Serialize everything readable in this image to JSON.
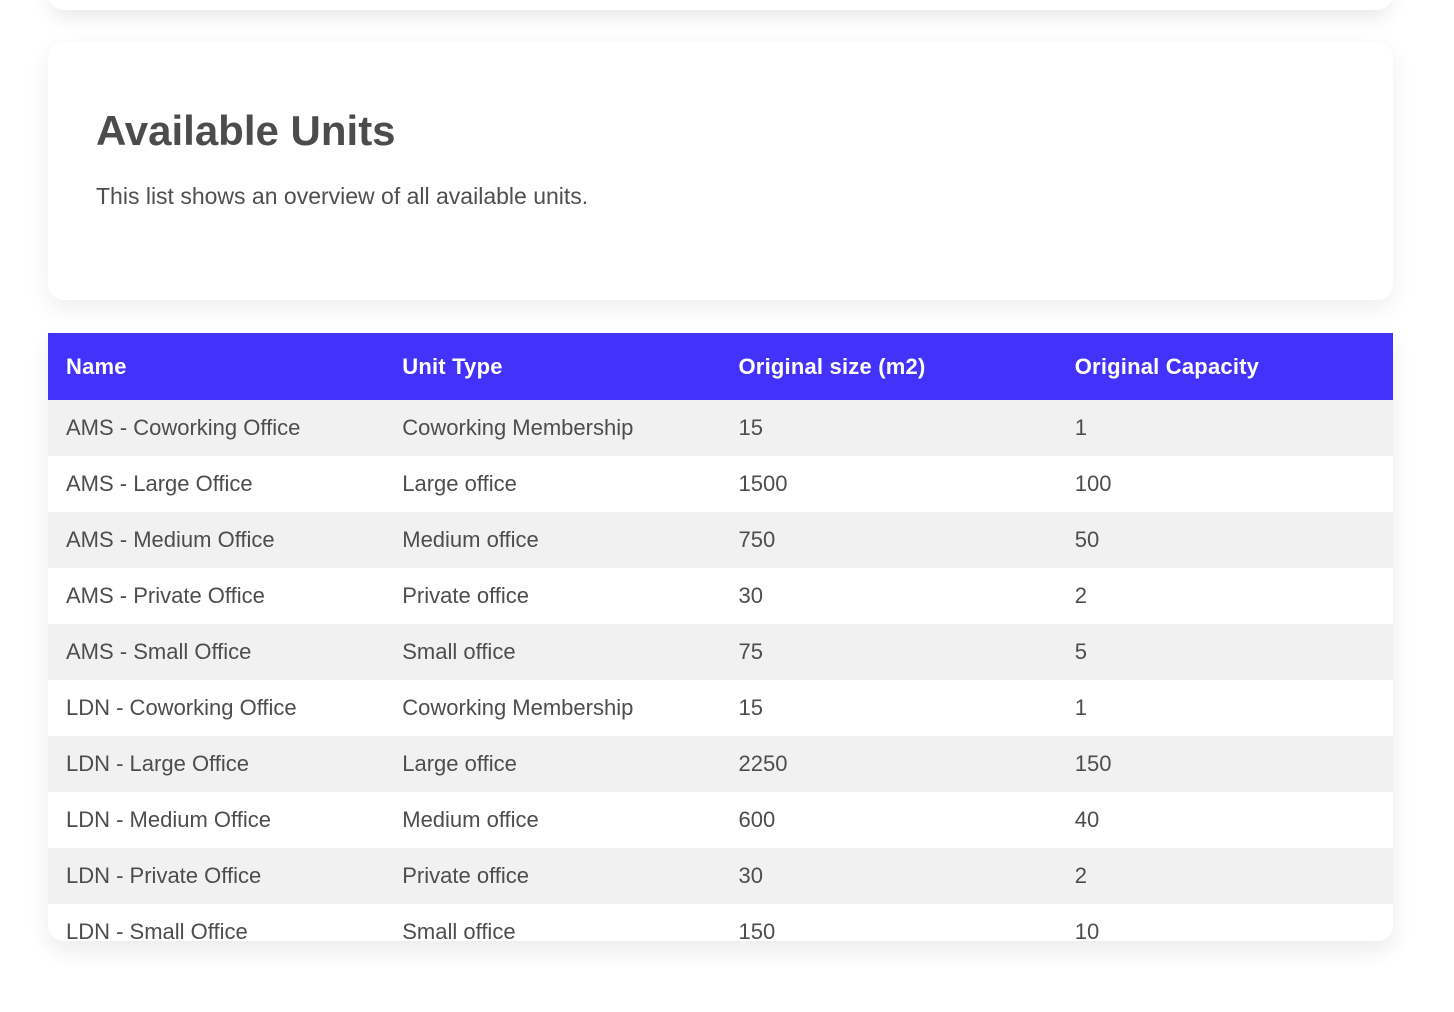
{
  "intro_card": {
    "title": "Available Units",
    "subtitle": "This list shows an overview of all available units."
  },
  "table": {
    "header_bg": "#4333fa",
    "header_text_color": "#ffffff",
    "stripe_color": "#f1f1f1",
    "row_text_color": "#4d4d4d",
    "columns": [
      "Name",
      "Unit Type",
      "Original size (m2)",
      "Original Capacity"
    ],
    "rows": [
      [
        "AMS - Coworking Office",
        "Coworking Membership",
        "15",
        "1"
      ],
      [
        "AMS - Large Office",
        "Large office",
        "1500",
        "100"
      ],
      [
        "AMS - Medium Office",
        "Medium office",
        "750",
        "50"
      ],
      [
        "AMS - Private Office",
        "Private office",
        "30",
        "2"
      ],
      [
        "AMS - Small Office",
        "Small office",
        "75",
        "5"
      ],
      [
        "LDN - Coworking Office",
        "Coworking Membership",
        "15",
        "1"
      ],
      [
        "LDN - Large Office",
        "Large office",
        "2250",
        "150"
      ],
      [
        "LDN - Medium Office",
        "Medium office",
        "600",
        "40"
      ],
      [
        "LDN - Private Office",
        "Private office",
        "30",
        "2"
      ],
      [
        "LDN - Small Office",
        "Small office",
        "150",
        "10"
      ]
    ]
  }
}
